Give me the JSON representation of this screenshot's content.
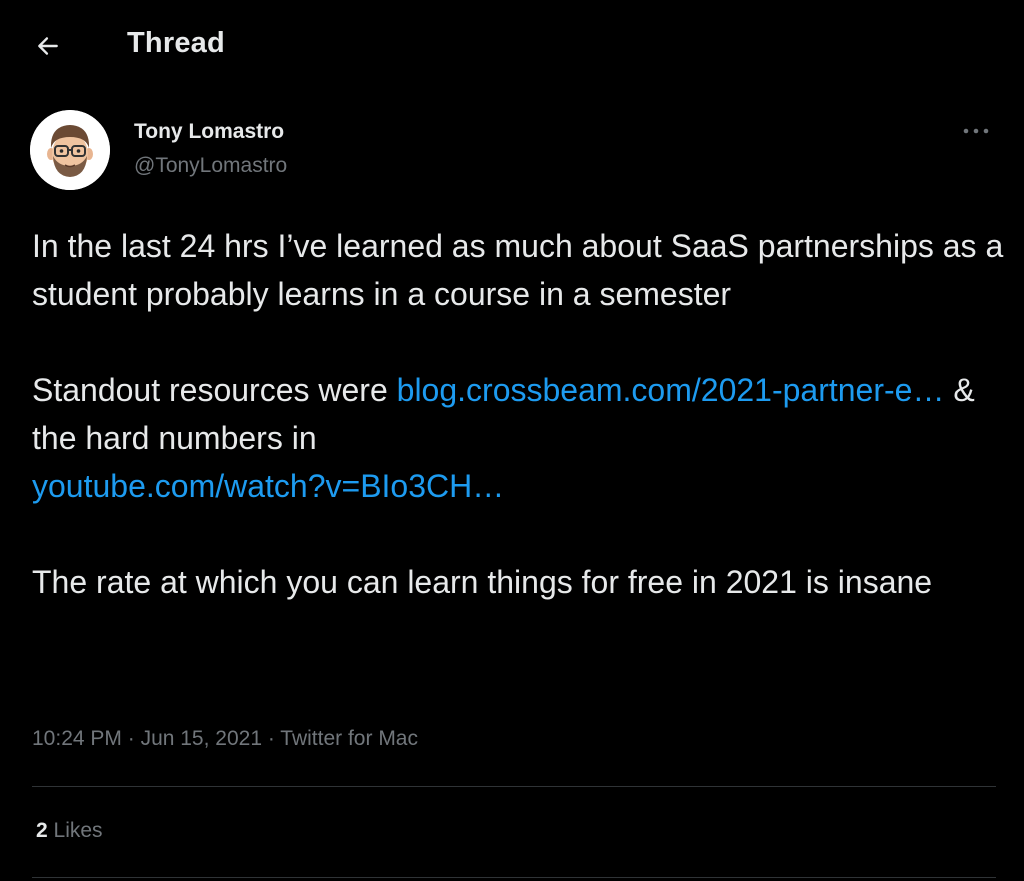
{
  "header": {
    "back_icon": "arrow-left-icon",
    "title": "Thread"
  },
  "tweet": {
    "author": {
      "name": "Tony Lomastro",
      "handle": "@TonyLomastro",
      "avatar_icon": "memoji-avatar"
    },
    "more_icon": "more-horizontal-icon",
    "text": {
      "para1": "In the last 24 hrs I’ve learned as much about SaaS partnerships as a student probably learns in a course in a semester",
      "para2_prefix": "Standout resources were ",
      "link1": "blog.crossbeam.com/2021-partner-e…",
      "para2_middle": " & the hard numbers in ",
      "link2": "youtube.com/watch?v=BIo3CH…",
      "para3": "The rate at which you can learn things for free in 2021 is insane"
    },
    "meta": {
      "time": "10:24 PM",
      "sep1": " · ",
      "date": "Jun 15, 2021",
      "sep2": " · ",
      "source": "Twitter for Mac"
    },
    "stats": {
      "likes_count": "2",
      "likes_label": "Likes"
    }
  },
  "colors": {
    "background": "#000000",
    "text": "#e7e9ea",
    "secondary": "#71767b",
    "link": "#1d9bf0",
    "divider": "#2f3336"
  }
}
